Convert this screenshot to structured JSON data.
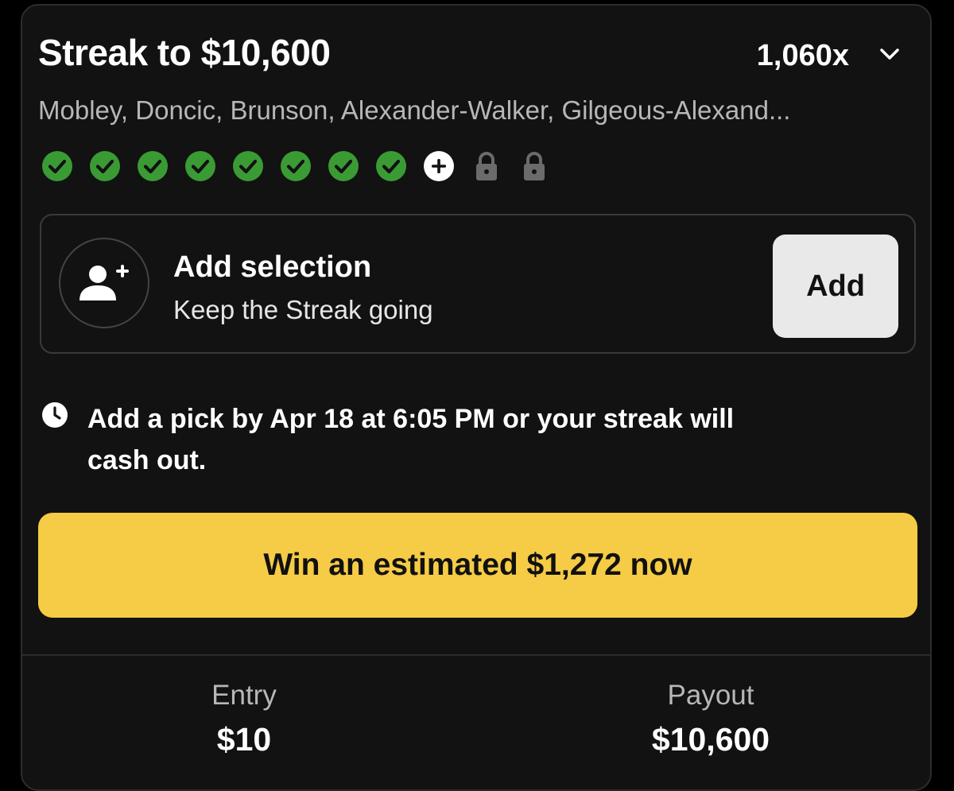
{
  "header": {
    "title": "Streak to $10,600",
    "multiplier": "1,060x"
  },
  "players": "Mobley, Doncic, Brunson, Alexander-Walker, Gilgeous-Alexand...",
  "progress": {
    "completed": 8,
    "current": 1,
    "locked": 2,
    "colors": {
      "completed": "#3a9b35",
      "current": "#ffffff",
      "locked": "#6b6b6b"
    }
  },
  "add_selection": {
    "title": "Add selection",
    "subtitle": "Keep the Streak going",
    "button_label": "Add"
  },
  "deadline": {
    "text": "Add a pick by Apr 18 at 6:05 PM or your streak will cash out."
  },
  "cashout": {
    "label": "Win an estimated $1,272 now",
    "color": "#f6cb45"
  },
  "summary": {
    "entry_label": "Entry",
    "entry_value": "$10",
    "payout_label": "Payout",
    "payout_value": "$10,600"
  }
}
